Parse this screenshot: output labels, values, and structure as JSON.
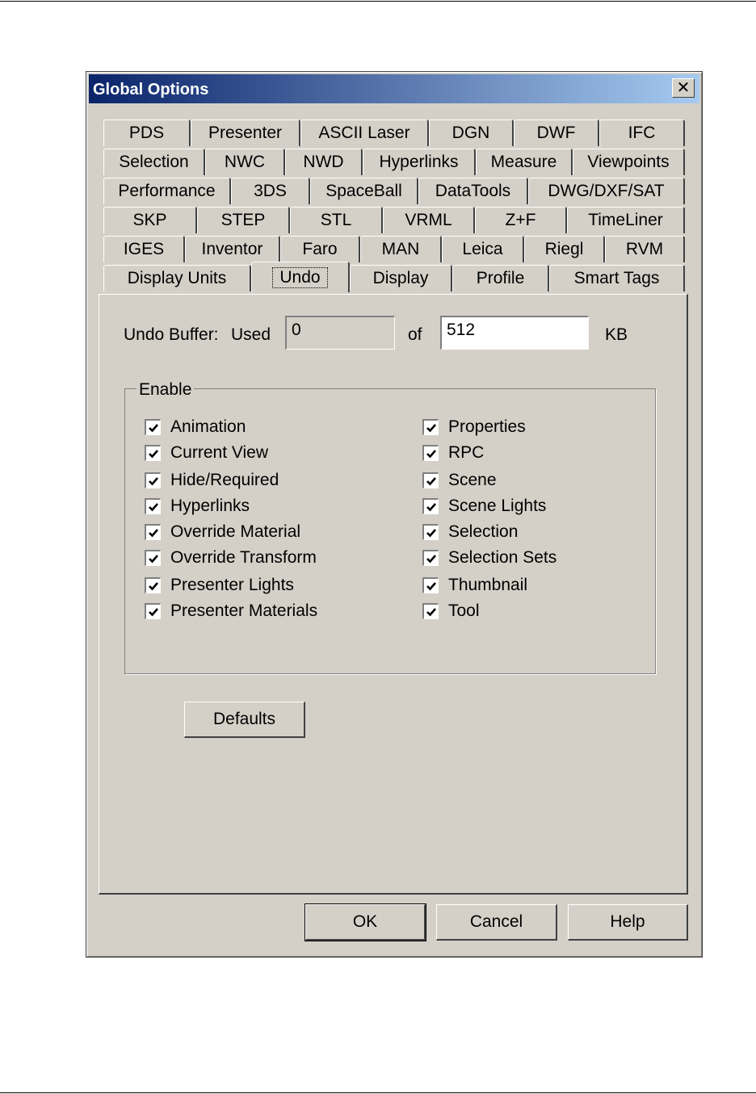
{
  "dialog": {
    "title": "Global Options",
    "close_symbol": "✕"
  },
  "tabs": {
    "row1": [
      "PDS",
      "Presenter",
      "ASCII Laser",
      "DGN",
      "DWF",
      "IFC"
    ],
    "row2": [
      "Selection",
      "NWC",
      "NWD",
      "Hyperlinks",
      "Measure",
      "Viewpoints"
    ],
    "row3": [
      "Performance",
      "3DS",
      "SpaceBall",
      "DataTools",
      "DWG/DXF/SAT"
    ],
    "row4": [
      "SKP",
      "STEP",
      "STL",
      "VRML",
      "Z+F",
      "TimeLiner"
    ],
    "row5": [
      "IGES",
      "Inventor",
      "Faro",
      "MAN",
      "Leica",
      "Riegl",
      "RVM"
    ],
    "row6": [
      "Display Units",
      "Undo",
      "Display",
      "Profile",
      "Smart Tags"
    ],
    "active": "Undo"
  },
  "undo": {
    "buffer_label": "Undo Buffer:",
    "used_label": "Used",
    "used_value": "0",
    "of_label": "of",
    "size_value": "512",
    "unit_label": "KB"
  },
  "enable": {
    "legend": "Enable",
    "left": [
      {
        "label": "Animation",
        "checked": true
      },
      {
        "label": "Current View",
        "checked": true
      },
      {
        "label": "Hide/Required",
        "checked": true
      },
      {
        "label": "Hyperlinks",
        "checked": true
      },
      {
        "label": "Override Material",
        "checked": true
      },
      {
        "label": "Override Transform",
        "checked": true
      },
      {
        "label": "Presenter Lights",
        "checked": true
      },
      {
        "label": "Presenter Materials",
        "checked": true
      }
    ],
    "right": [
      {
        "label": "Properties",
        "checked": true
      },
      {
        "label": "RPC",
        "checked": true
      },
      {
        "label": "Scene",
        "checked": true
      },
      {
        "label": "Scene Lights",
        "checked": true
      },
      {
        "label": "Selection",
        "checked": true
      },
      {
        "label": "Selection Sets",
        "checked": true
      },
      {
        "label": "Thumbnail",
        "checked": true
      },
      {
        "label": "Tool",
        "checked": true
      }
    ]
  },
  "buttons": {
    "defaults": "Defaults",
    "ok": "OK",
    "cancel": "Cancel",
    "help": "Help"
  },
  "colors": {
    "title_gradient_start": "#0a246a",
    "title_gradient_end": "#a6caf0",
    "face": "#d4d0c8"
  }
}
